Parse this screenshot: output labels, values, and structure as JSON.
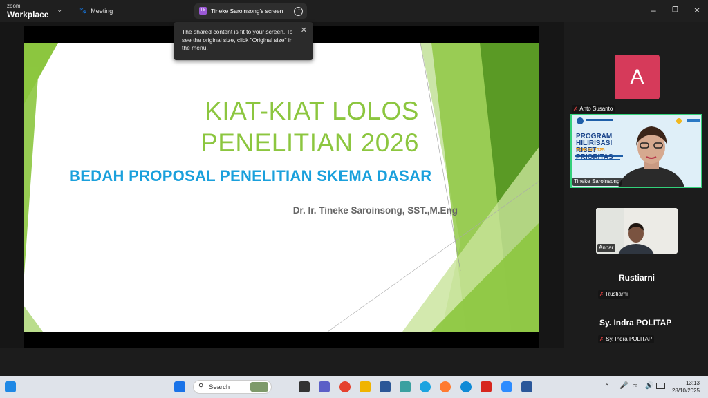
{
  "app": {
    "brand_small": "zoom",
    "brand_large": "Workplace",
    "meeting_label": "Meeting"
  },
  "share": {
    "initials": "TS",
    "label": "Tineke Saroinsong's screen"
  },
  "tooltip": {
    "text": "The shared content is fit to your screen. To see the original size, click \"Original size\" in the menu."
  },
  "slide": {
    "title_line1": "KIAT-KIAT LOLOS",
    "title_line2": "PENELITIAN 2026",
    "subtitle": "BEDAH PROPOSAL PENELITIAN SKEMA DASAR",
    "author": "Dr. Ir. Tineke Saroinsong, SST.,M.Eng"
  },
  "participants": [
    {
      "name": "Anto Susanto",
      "avatar_letter": "A"
    },
    {
      "name": "Tineke Saroinsong",
      "video_title": "PROGRAM HILIRISASI RISET PRIORITAS",
      "video_year": "TAHUN 2025"
    },
    {
      "name": "Anhar"
    },
    {
      "name": "Rustiarni"
    },
    {
      "name": "Sy. Indra POLITAP"
    }
  ],
  "taskbar": {
    "search_label": "Search",
    "time": "13:13",
    "date": "28/10/2025"
  },
  "colors": {
    "slide_green": "#8cc63f",
    "slide_blue": "#1aa0dc",
    "avatar_bg": "#d63a5a",
    "active_speaker": "#33d07a"
  }
}
